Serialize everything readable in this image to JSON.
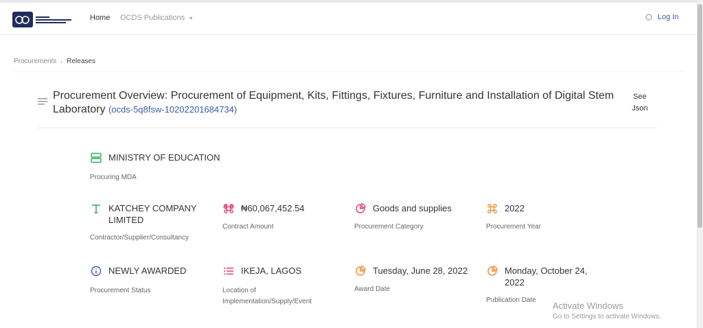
{
  "navbar": {
    "logo_text": "PUBLIC PROCUREMENT AGENCY",
    "home": "Home",
    "ocds_publications": "OCDS Publications",
    "login": "Log In"
  },
  "breadcrumb": {
    "items": [
      "Procurements",
      "Releases"
    ]
  },
  "header": {
    "title": "Procurement Overview: Procurement of Equipment, Kits, Fittings, Fixtures, Furniture and Installation of Digital Stem Laboratory",
    "ocid": "(ocds-5q8fsw-10202201684734)",
    "see_json": "See Json"
  },
  "details": {
    "mda": {
      "value": "MINISTRY OF EDUCATION",
      "label": "Procuring MDA",
      "icon": "server-icon",
      "color": "#2eab5a"
    },
    "contractor": {
      "value": "KATCHEY COMPANY LIMITED",
      "label": "Contractor/Supplier/Consultancy",
      "icon": "text-t-icon",
      "color": "#2eab5a"
    },
    "amount": {
      "value": "₦60,067,452.54",
      "label": "Contract Amount",
      "icon": "command-icon",
      "color": "#e23b6c"
    },
    "category": {
      "value": "Goods and supplies",
      "label": "Procurement Category",
      "icon": "pie-chart-icon",
      "color": "#e23b6c"
    },
    "year": {
      "value": "2022",
      "label": "Procurement Year",
      "icon": "command-icon",
      "color": "#f08a24"
    },
    "status": {
      "value": "NEWLY AWARDED",
      "label": "Procurement Status",
      "icon": "info-icon",
      "color": "#3b5ba5"
    },
    "location": {
      "value": "IKEJA, LAGOS",
      "label": "Location of Implementation/Supply/Event",
      "icon": "list-icon",
      "color": "#e23b6c"
    },
    "award_date": {
      "value": "Tuesday, June 28, 2022",
      "label": "Award Date",
      "icon": "pie-chart-icon",
      "color": "#f08a24"
    },
    "publication_date": {
      "value": "Monday, October 24, 2022",
      "label": "Publication Date",
      "icon": "pie-chart-icon",
      "color": "#f08a24"
    }
  },
  "watermark": {
    "line1": "Activate Windows",
    "line2": "Go to Settings to activate Windows."
  }
}
